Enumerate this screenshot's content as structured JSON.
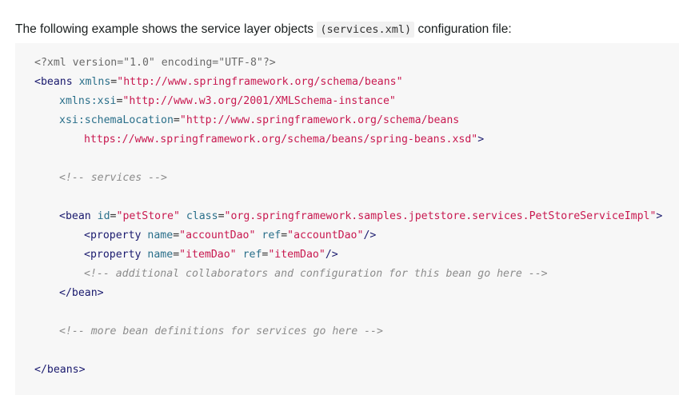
{
  "intro": {
    "before": "The following example shows the service layer objects ",
    "code": "(services.xml)",
    "after": " configuration file:"
  },
  "code": {
    "l1": "<?xml version=\"1.0\" encoding=\"UTF-8\"?>",
    "l2": {
      "open": "<beans",
      "a1": "xmlns",
      "v1": "\"http://www.springframework.org/schema/beans\""
    },
    "l3": {
      "a": "xmlns:xsi",
      "v": "\"http://www.w3.org/2001/XMLSchema-instance\""
    },
    "l4": {
      "a": "xsi:schemaLocation",
      "v": "\"http://www.springframework.org/schema/beans"
    },
    "l5": {
      "v": "https://www.springframework.org/schema/beans/spring-beans.xsd\"",
      "close": ">"
    },
    "l7": "<!-- services -->",
    "l9": {
      "open": "<bean",
      "a1": "id",
      "v1": "\"petStore\"",
      "a2": "class",
      "v2": "\"org.springframework.samples.jpetstore.services.PetStoreServiceImpl\"",
      "close": ">"
    },
    "l10": {
      "open": "<property",
      "a1": "name",
      "v1": "\"accountDao\"",
      "a2": "ref",
      "v2": "\"accountDao\"",
      "close": "/>"
    },
    "l11": {
      "open": "<property",
      "a1": "name",
      "v1": "\"itemDao\"",
      "a2": "ref",
      "v2": "\"itemDao\"",
      "close": "/>"
    },
    "l12": "<!-- additional collaborators and configuration for this bean go here -->",
    "l13": "</bean>",
    "l15": "<!-- more bean definitions for services go here -->",
    "l17": "</beans>"
  },
  "colors": {
    "code_background": "#f7f7f7",
    "tag": "#1a1a6e",
    "attribute": "#2a6f8a",
    "string": "#c8184f",
    "comment": "#8c8c8c"
  }
}
